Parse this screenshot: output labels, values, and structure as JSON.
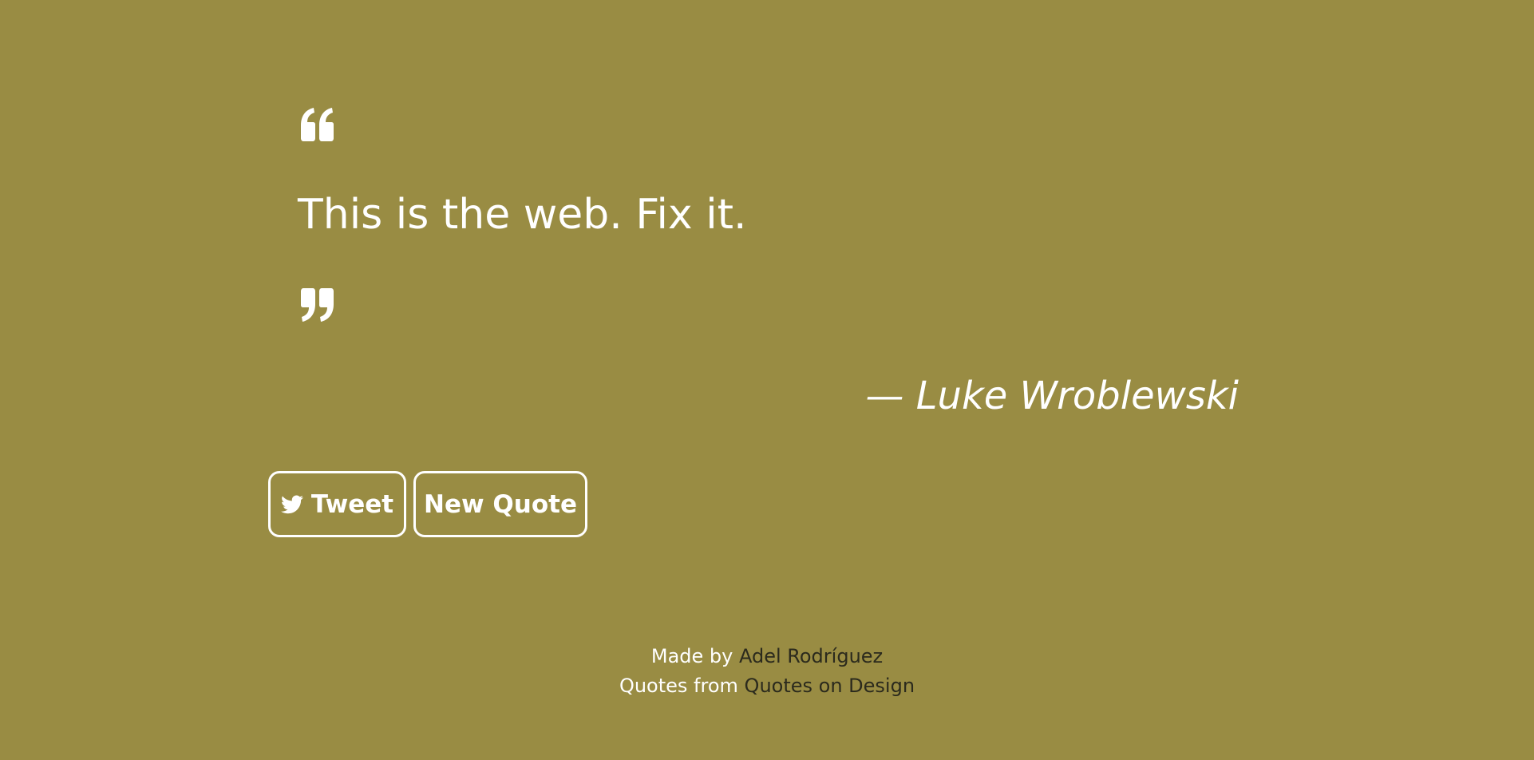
{
  "theme": {
    "background": "#998c43",
    "text": "#ffffff",
    "link": "#2b2a1d"
  },
  "quote": {
    "open_icon": "quote-left-icon",
    "text": "This is the web. Fix it.",
    "close_icon": "quote-right-icon",
    "author": "— Luke Wroblewski"
  },
  "actions": {
    "tweet": {
      "icon": "twitter-icon",
      "label": "Tweet"
    },
    "new_quote": {
      "label": "New Quote"
    }
  },
  "footer": {
    "made_by_prefix": "Made by",
    "made_by_link": "Adel Rodríguez",
    "quotes_prefix": "Quotes from",
    "quotes_link": "Quotes on Design"
  }
}
